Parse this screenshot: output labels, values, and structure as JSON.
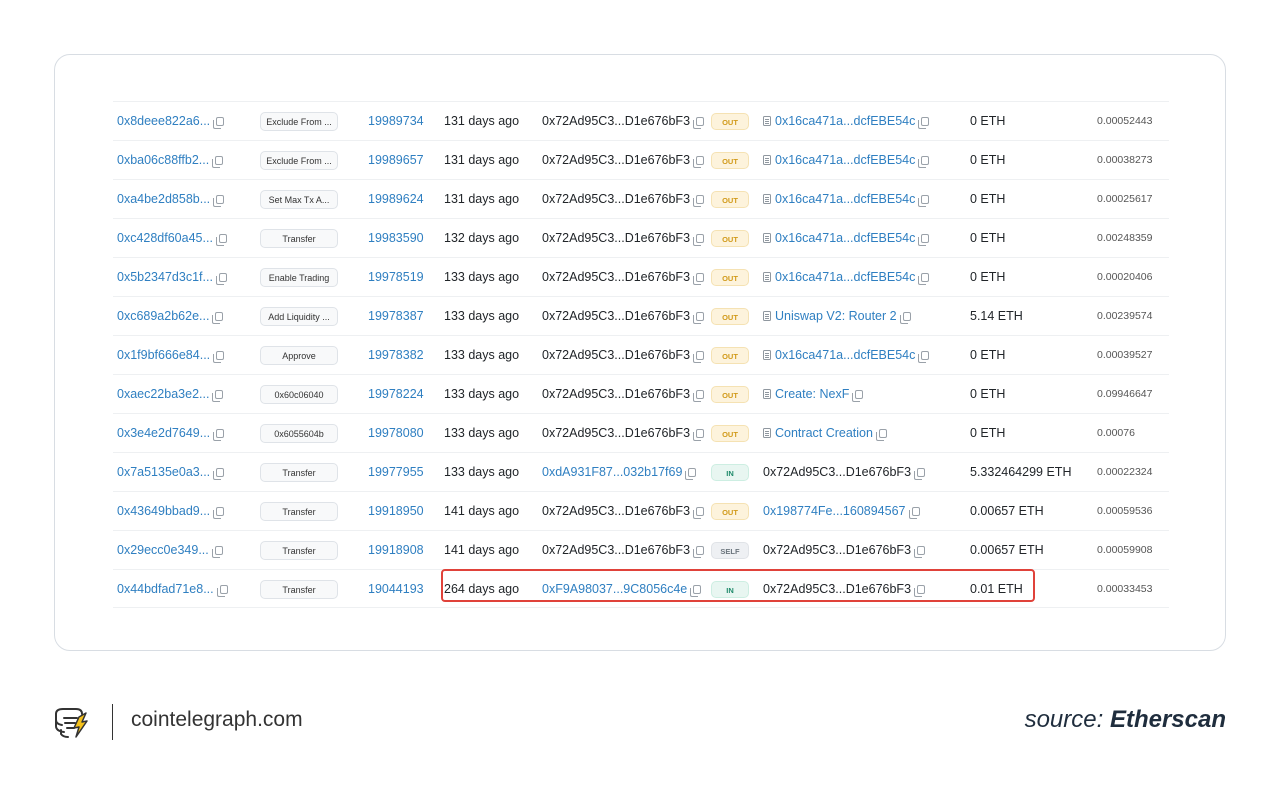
{
  "transactions": [
    {
      "hash": "0x8deee822a6...",
      "method": "Exclude From ...",
      "block": "19989734",
      "age": "131 days ago",
      "from": "0x72Ad95C3...D1e676bF3",
      "from_link": false,
      "direction": "OUT",
      "to": "0x16ca471a...dcfEBE54c",
      "to_icon": "contract-icon",
      "to_link": true,
      "value": "0 ETH",
      "fee": "0.00052443"
    },
    {
      "hash": "0xba06c88ffb2...",
      "method": "Exclude From ...",
      "block": "19989657",
      "age": "131 days ago",
      "from": "0x72Ad95C3...D1e676bF3",
      "from_link": false,
      "direction": "OUT",
      "to": "0x16ca471a...dcfEBE54c",
      "to_icon": "contract-icon",
      "to_link": true,
      "value": "0 ETH",
      "fee": "0.00038273"
    },
    {
      "hash": "0xa4be2d858b...",
      "method": "Set Max Tx A...",
      "block": "19989624",
      "age": "131 days ago",
      "from": "0x72Ad95C3...D1e676bF3",
      "from_link": false,
      "direction": "OUT",
      "to": "0x16ca471a...dcfEBE54c",
      "to_icon": "contract-icon",
      "to_link": true,
      "value": "0 ETH",
      "fee": "0.00025617"
    },
    {
      "hash": "0xc428df60a45...",
      "method": "Transfer",
      "block": "19983590",
      "age": "132 days ago",
      "from": "0x72Ad95C3...D1e676bF3",
      "from_link": false,
      "direction": "OUT",
      "to": "0x16ca471a...dcfEBE54c",
      "to_icon": "contract-icon",
      "to_link": true,
      "value": "0 ETH",
      "fee": "0.00248359"
    },
    {
      "hash": "0x5b2347d3c1f...",
      "method": "Enable Trading",
      "block": "19978519",
      "age": "133 days ago",
      "from": "0x72Ad95C3...D1e676bF3",
      "from_link": false,
      "direction": "OUT",
      "to": "0x16ca471a...dcfEBE54c",
      "to_icon": "contract-icon",
      "to_link": true,
      "value": "0 ETH",
      "fee": "0.00020406"
    },
    {
      "hash": "0xc689a2b62e...",
      "method": "Add Liquidity ...",
      "block": "19978387",
      "age": "133 days ago",
      "from": "0x72Ad95C3...D1e676bF3",
      "from_link": false,
      "direction": "OUT",
      "to": "Uniswap V2: Router 2",
      "to_icon": "contract-icon",
      "to_link": true,
      "value": "5.14 ETH",
      "fee": "0.00239574"
    },
    {
      "hash": "0x1f9bf666e84...",
      "method": "Approve",
      "block": "19978382",
      "age": "133 days ago",
      "from": "0x72Ad95C3...D1e676bF3",
      "from_link": false,
      "direction": "OUT",
      "to": "0x16ca471a...dcfEBE54c",
      "to_icon": "contract-icon",
      "to_link": true,
      "value": "0 ETH",
      "fee": "0.00039527"
    },
    {
      "hash": "0xaec22ba3e2...",
      "method": "0x60c06040",
      "block": "19978224",
      "age": "133 days ago",
      "from": "0x72Ad95C3...D1e676bF3",
      "from_link": false,
      "direction": "OUT",
      "to": "Create: NexF",
      "to_icon": "contract-creation-icon",
      "to_link": true,
      "value": "0 ETH",
      "fee": "0.09946647"
    },
    {
      "hash": "0x3e4e2d7649...",
      "method": "0x6055604b",
      "block": "19978080",
      "age": "133 days ago",
      "from": "0x72Ad95C3...D1e676bF3",
      "from_link": false,
      "direction": "OUT",
      "to": "Contract Creation",
      "to_icon": "contract-creation-icon",
      "to_link": true,
      "value": "0 ETH",
      "fee": "0.00076"
    },
    {
      "hash": "0x7a5135e0a3...",
      "method": "Transfer",
      "block": "19977955",
      "age": "133 days ago",
      "from": "0xdA931F87...032b17f69",
      "from_link": true,
      "direction": "IN",
      "to": "0x72Ad95C3...D1e676bF3",
      "to_icon": "",
      "to_link": false,
      "value": "5.332464299 ETH",
      "fee": "0.00022324"
    },
    {
      "hash": "0x43649bbad9...",
      "method": "Transfer",
      "block": "19918950",
      "age": "141 days ago",
      "from": "0x72Ad95C3...D1e676bF3",
      "from_link": false,
      "direction": "OUT",
      "to": "0x198774Fe...160894567",
      "to_icon": "",
      "to_link": true,
      "value": "0.00657 ETH",
      "fee": "0.00059536"
    },
    {
      "hash": "0x29ecc0e349...",
      "method": "Transfer",
      "block": "19918908",
      "age": "141 days ago",
      "from": "0x72Ad95C3...D1e676bF3",
      "from_link": false,
      "direction": "SELF",
      "to": "0x72Ad95C3...D1e676bF3",
      "to_icon": "",
      "to_link": false,
      "value": "0.00657 ETH",
      "fee": "0.00059908"
    },
    {
      "hash": "0x44bdfad71e8...",
      "method": "Transfer",
      "block": "19044193",
      "age": "264 days ago",
      "from": "0xF9A98037...9C8056c4e",
      "from_link": true,
      "direction": "IN",
      "to": "0x72Ad95C3...D1e676bF3",
      "to_icon": "",
      "to_link": false,
      "value": "0.01 ETH",
      "fee": "0.00033453"
    }
  ],
  "footer": {
    "site": "cointelegraph.com",
    "source_prefix": "source: ",
    "source_name": "Etherscan"
  },
  "colors": {
    "link": "#2f7fc1",
    "highlight": "#e0423a",
    "out_badge": "#d19a1a",
    "in_badge": "#1e8a6a"
  }
}
